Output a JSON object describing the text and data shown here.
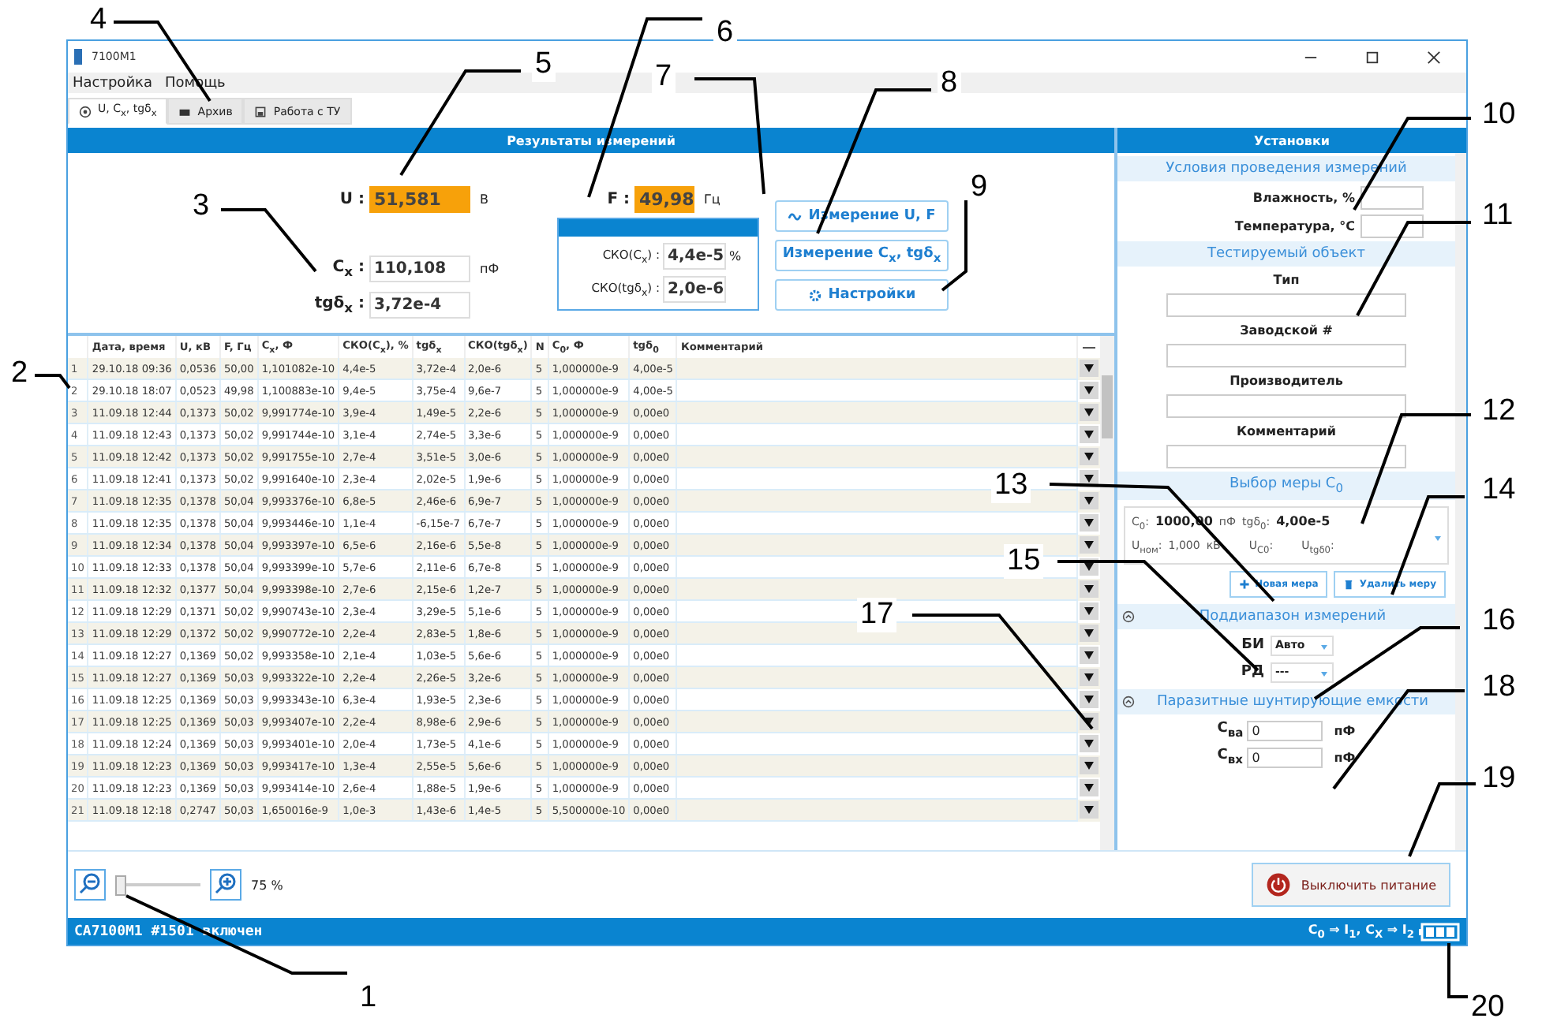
{
  "window": {
    "title": "7100M1"
  },
  "menu": [
    {
      "label": "Настройка"
    },
    {
      "label": "Помощь"
    }
  ],
  "tabs": [
    {
      "label": "U, C$_{x}$, tgδ$_{x}$",
      "kind": "target",
      "selected": true
    },
    {
      "label": "Архив",
      "kind": "archive",
      "selected": false
    },
    {
      "label": "Работа с ТУ",
      "kind": "save",
      "selected": false
    }
  ],
  "results": {
    "header": "Результаты измерений",
    "u": {
      "label": "U :",
      "value": "51,581",
      "unit": "В",
      "highlighted": true
    },
    "f": {
      "label": "F :",
      "value": "49,98",
      "unit": "Гц",
      "highlighted": true
    },
    "cx": {
      "label": "C$_{x}$ :",
      "value": "110,108",
      "unit": "пФ",
      "highlighted": false
    },
    "tg": {
      "label": "tgδ$_{x}$ :",
      "value": "3,72e-4",
      "highlighted": false
    },
    "sko": [
      {
        "label": "СКО(C$_{x}$) :",
        "value": "4,4e-5",
        "unit": "%"
      },
      {
        "label": "СКО(tgδ$_{x}$) :",
        "value": "2,0e-6"
      }
    ],
    "buttons": [
      {
        "label": "Измерение U, F",
        "kind": "wave"
      },
      {
        "label": "Измерение C$_{x}$, tgδ$_{x}$",
        "kind": "none"
      },
      {
        "label": "Настройки",
        "kind": "gear"
      }
    ]
  },
  "table": {
    "columns": [
      "",
      "Дата, время",
      "U, кВ",
      "F, Гц",
      "C$_{x}$, Ф",
      "СКО(C$_{x}$), %",
      "tgδ$_{x}$",
      "СКО(tgδ$_{x}$)",
      "N",
      "C$_{0}$, Ф",
      "tgδ$_{0}$",
      "Комментарий"
    ],
    "rows": [
      [
        "1",
        "29.10.18 09:36",
        "0,0536",
        "50,00",
        "1,101082e-10",
        "4,4e-5",
        "3,72e-4",
        "2,0e-6",
        "5",
        "1,000000e-9",
        "4,00e-5"
      ],
      [
        "2",
        "29.10.18 18:07",
        "0,0523",
        "49,98",
        "1,100883e-10",
        "9,4e-5",
        "3,75e-4",
        "9,6e-7",
        "5",
        "1,000000e-9",
        "4,00e-5"
      ],
      [
        "3",
        "11.09.18 12:44",
        "0,1373",
        "50,02",
        "9,991774e-10",
        "3,9e-4",
        "1,49e-5",
        "2,2e-6",
        "5",
        "1,000000e-9",
        "0,00e0"
      ],
      [
        "4",
        "11.09.18 12:43",
        "0,1373",
        "50,02",
        "9,991744e-10",
        "3,1e-4",
        "2,74e-5",
        "3,3e-6",
        "5",
        "1,000000e-9",
        "0,00e0"
      ],
      [
        "5",
        "11.09.18 12:42",
        "0,1373",
        "50,02",
        "9,991755e-10",
        "2,7e-4",
        "3,51e-5",
        "3,0e-6",
        "5",
        "1,000000e-9",
        "0,00e0"
      ],
      [
        "6",
        "11.09.18 12:41",
        "0,1373",
        "50,02",
        "9,991640e-10",
        "2,3e-4",
        "2,02e-5",
        "1,9e-6",
        "5",
        "1,000000e-9",
        "0,00e0"
      ],
      [
        "7",
        "11.09.18 12:35",
        "0,1378",
        "50,04",
        "9,993376e-10",
        "6,8e-5",
        "2,46e-6",
        "6,9e-7",
        "5",
        "1,000000e-9",
        "0,00e0"
      ],
      [
        "8",
        "11.09.18 12:35",
        "0,1378",
        "50,04",
        "9,993446e-10",
        "1,1e-4",
        "-6,15e-7",
        "6,7e-7",
        "5",
        "1,000000e-9",
        "0,00e0"
      ],
      [
        "9",
        "11.09.18 12:34",
        "0,1378",
        "50,04",
        "9,993397e-10",
        "6,5e-6",
        "2,16e-6",
        "5,5e-8",
        "5",
        "1,000000e-9",
        "0,00e0"
      ],
      [
        "10",
        "11.09.18 12:33",
        "0,1378",
        "50,04",
        "9,993399e-10",
        "5,7e-6",
        "2,11e-6",
        "6,7e-8",
        "5",
        "1,000000e-9",
        "0,00e0"
      ],
      [
        "11",
        "11.09.18 12:32",
        "0,1377",
        "50,04",
        "9,993398e-10",
        "2,7e-6",
        "2,15e-6",
        "1,2e-7",
        "5",
        "1,000000e-9",
        "0,00e0"
      ],
      [
        "12",
        "11.09.18 12:29",
        "0,1371",
        "50,02",
        "9,990743e-10",
        "2,3e-4",
        "3,29e-5",
        "5,1e-6",
        "5",
        "1,000000e-9",
        "0,00e0"
      ],
      [
        "13",
        "11.09.18 12:29",
        "0,1372",
        "50,02",
        "9,990772e-10",
        "2,2e-4",
        "2,83e-5",
        "1,8e-6",
        "5",
        "1,000000e-9",
        "0,00e0"
      ],
      [
        "14",
        "11.09.18 12:27",
        "0,1369",
        "50,02",
        "9,993358e-10",
        "2,1e-4",
        "1,03e-5",
        "5,6e-6",
        "5",
        "1,000000e-9",
        "0,00e0"
      ],
      [
        "15",
        "11.09.18 12:27",
        "0,1369",
        "50,03",
        "9,993322e-10",
        "2,2e-4",
        "2,26e-5",
        "3,2e-6",
        "5",
        "1,000000e-9",
        "0,00e0"
      ],
      [
        "16",
        "11.09.18 12:25",
        "0,1369",
        "50,03",
        "9,993343e-10",
        "6,3e-4",
        "1,93e-5",
        "2,3e-6",
        "5",
        "1,000000e-9",
        "0,00e0"
      ],
      [
        "17",
        "11.09.18 12:25",
        "0,1369",
        "50,03",
        "9,993407e-10",
        "2,2e-4",
        "8,98e-6",
        "2,9e-6",
        "5",
        "1,000000e-9",
        "0,00e0"
      ],
      [
        "18",
        "11.09.18 12:24",
        "0,1369",
        "50,03",
        "9,993401e-10",
        "2,0e-4",
        "1,73e-5",
        "4,1e-6",
        "5",
        "1,000000e-9",
        "0,00e0"
      ],
      [
        "19",
        "11.09.18 12:23",
        "0,1369",
        "50,03",
        "9,993417e-10",
        "1,3e-4",
        "2,55e-5",
        "5,6e-6",
        "5",
        "1,000000e-9",
        "0,00e0"
      ],
      [
        "20",
        "11.09.18 12:23",
        "0,1369",
        "50,03",
        "9,993414e-10",
        "2,6e-4",
        "1,88e-5",
        "1,9e-6",
        "5",
        "1,000000e-9",
        "0,00e0"
      ],
      [
        "21",
        "11.09.18 12:18",
        "0,2747",
        "50,03",
        "1,650016e-9",
        "1,0e-3",
        "1,43e-6",
        "1,4e-5",
        "5",
        "5,500000e-10",
        "0,00e0"
      ]
    ]
  },
  "settings": {
    "header": "Установки",
    "conditions": {
      "title": "Условия проведения измерений",
      "fields": [
        {
          "label": "Влажность, %"
        },
        {
          "label": "Температура, °C"
        }
      ]
    },
    "object": {
      "title": "Тестируемый объект",
      "fields": [
        {
          "label": "Тип"
        },
        {
          "label": "Заводской #"
        },
        {
          "label": "Производитель"
        },
        {
          "label": "Комментарий"
        }
      ]
    },
    "measure": {
      "title": "Выбор меры C$_{0}$",
      "c0_label": "C$_{0}$:",
      "c0_value": "1000,00",
      "c0_unit": "пФ",
      "tg_label": "tgδ$_{0}$:",
      "tg_value": "4,00e-5",
      "unom_label": "U$_{ном}$:",
      "unom_value": "1,000",
      "unom_unit": "кВ",
      "uc_label": "U$_{C0}$:",
      "utg_label": "U$_{tgδ0}$:",
      "buttons": [
        {
          "label": "Новая мера",
          "kind": "plus"
        },
        {
          "label": "Удалить меру",
          "kind": "trash"
        }
      ]
    },
    "range": {
      "title": "Поддиапазон измерений",
      "selects": [
        {
          "label": "БИ",
          "value": "Авто"
        },
        {
          "label": "РД",
          "value": "---"
        }
      ]
    },
    "parasitic": {
      "title": "Паразитные шунтирующие емкости",
      "fields": [
        {
          "label": "C$_{ва}$",
          "value": "0",
          "unit": "пФ"
        },
        {
          "label": "C$_{вх}$",
          "value": "0",
          "unit": "пФ"
        }
      ]
    }
  },
  "zoom": {
    "level": 0,
    "reading": "75 %"
  },
  "power_button": {
    "label": "Выключить питание"
  },
  "status_bar": {
    "device": "CA7100M1 #1501 включен",
    "mapping": "C$_{0}$ ⇒ I$_{1}$, C$_{X}$ ⇒ I$_{2}$"
  },
  "callouts": [
    {
      "label": "1"
    },
    {
      "label": "2"
    },
    {
      "label": "3"
    },
    {
      "label": "4"
    },
    {
      "label": "5"
    },
    {
      "label": "6"
    },
    {
      "label": "7"
    },
    {
      "label": "8"
    },
    {
      "label": "9"
    },
    {
      "label": "10"
    },
    {
      "label": "11"
    },
    {
      "label": "12"
    },
    {
      "label": "13"
    },
    {
      "label": "14"
    },
    {
      "label": "15"
    },
    {
      "label": "16"
    },
    {
      "label": "17"
    },
    {
      "label": "18"
    },
    {
      "label": "19"
    },
    {
      "label": "20"
    }
  ]
}
